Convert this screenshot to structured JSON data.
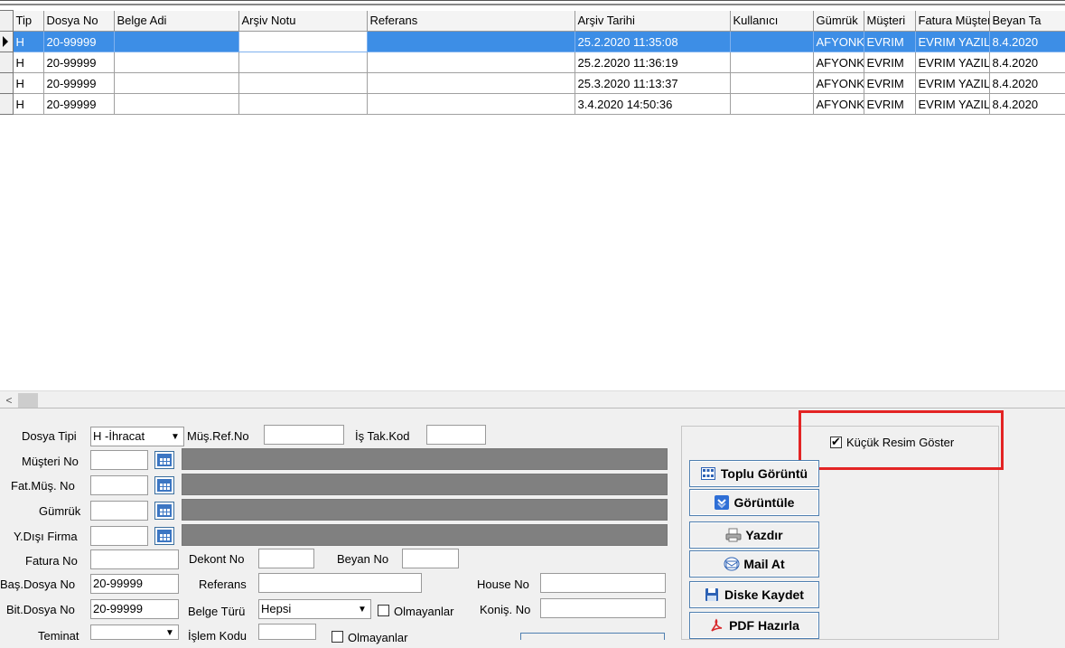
{
  "grid": {
    "columns": [
      "Tip",
      "Dosya No",
      "Belge Adi",
      "Arşiv Notu",
      "Referans",
      "Arşiv Tarihi",
      "Kullanıcı",
      "Gümrük",
      "Müşteri",
      "Fatura Müşteri",
      "Beyan Ta"
    ],
    "rows": [
      {
        "tip": "H",
        "dosya_no": "20-99999",
        "belge_adi": "",
        "arsiv_notu": "",
        "referans": "",
        "arsiv_tarihi": "25.2.2020 11:35:08",
        "kullanici": "",
        "gumruk": "AFYONK",
        "musteri": "EVRIM",
        "fatura_musteri": "EVRIM YAZIL",
        "beyan_tarihi": "8.4.2020",
        "selected": true
      },
      {
        "tip": "H",
        "dosya_no": "20-99999",
        "belge_adi": "",
        "arsiv_notu": "",
        "referans": "",
        "arsiv_tarihi": "25.2.2020 11:36:19",
        "kullanici": "",
        "gumruk": "AFYONK",
        "musteri": "EVRIM",
        "fatura_musteri": "EVRIM YAZIL",
        "beyan_tarihi": "8.4.2020",
        "selected": false
      },
      {
        "tip": "H",
        "dosya_no": "20-99999",
        "belge_adi": "",
        "arsiv_notu": "",
        "referans": "",
        "arsiv_tarihi": "25.3.2020 11:13:37",
        "kullanici": "",
        "gumruk": "AFYONK",
        "musteri": "EVRIM",
        "fatura_musteri": "EVRIM YAZIL",
        "beyan_tarihi": "8.4.2020",
        "selected": false
      },
      {
        "tip": "H",
        "dosya_no": "20-99999",
        "belge_adi": "",
        "arsiv_notu": "",
        "referans": "",
        "arsiv_tarihi": "3.4.2020 14:50:36",
        "kullanici": "",
        "gumruk": "AFYONK",
        "musteri": "EVRIM",
        "fatura_musteri": "EVRIM YAZIL",
        "beyan_tarihi": "8.4.2020",
        "selected": false
      }
    ]
  },
  "scrollbar": {
    "left_arrow": "<"
  },
  "form": {
    "dosya_tipi_label": "Dosya Tipi",
    "dosya_tipi_value": "H -İhracat",
    "mus_ref_no_label": "Müş.Ref.No",
    "mus_ref_no_value": "",
    "is_tak_kod_label": "İş Tak.Kod",
    "is_tak_kod_value": "",
    "musteri_no_label": "Müşteri No",
    "fat_mus_no_label": "Fat.Müş. No",
    "gumruk_label": "Gümrük",
    "y_disi_firma_label": "Y.Dışı Firma",
    "fatura_no_label": "Fatura No",
    "dekont_no_label": "Dekont No",
    "beyan_no_label": "Beyan No",
    "bas_dosya_no_label": "Baş.Dosya No",
    "bas_dosya_no_value": "20-99999",
    "referans_label": "Referans",
    "house_no_label": "House No",
    "bit_dosya_no_label": "Bit.Dosya No",
    "bit_dosya_no_value": "20-99999",
    "belge_turu_label": "Belge Türü",
    "belge_turu_value": "Hepsi",
    "olmayanlar_label": "Olmayanlar",
    "konis_no_label": "Koniş. No",
    "teminat_label": "Teminat",
    "islem_kodu_label": "İşlem Kodu",
    "olmayanlar2_label": "Olmayanlar"
  },
  "panel": {
    "kucuk_resim_label": "Küçük Resim Göster",
    "kucuk_resim_checked": true,
    "toplu_goruntu": "Toplu Görüntü",
    "goruntule": "Görüntüle",
    "yazdir": "Yazdır",
    "mail_at": "Mail At",
    "diske_kaydet": "Diske Kaydet",
    "pdf_hazirla": "PDF Hazırla"
  },
  "colors": {
    "selection": "#3d8ee6",
    "highlight_box": "#e32424",
    "disabled_field": "#808080"
  }
}
